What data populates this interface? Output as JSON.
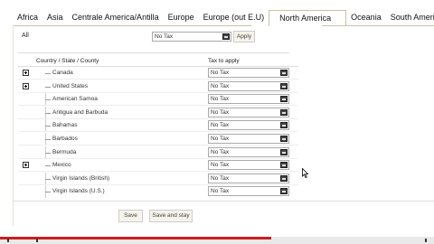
{
  "tabs": [
    {
      "label": "Africa",
      "active": false
    },
    {
      "label": "Asia",
      "active": false
    },
    {
      "label": "Centrale America/Antilla",
      "active": false
    },
    {
      "label": "Europe",
      "active": false
    },
    {
      "label": "Europe (out E.U)",
      "active": false
    },
    {
      "label": "North America",
      "active": true
    },
    {
      "label": "Oceania",
      "active": false
    },
    {
      "label": "South America",
      "active": false
    }
  ],
  "all_row": {
    "label": "All",
    "select_value": "No Tax",
    "apply_label": "Apply"
  },
  "table": {
    "col_country": "Country / State / County",
    "col_tax": "Tax to apply",
    "rows": [
      {
        "name": "Canada",
        "tax": "No Tax",
        "expandable": true
      },
      {
        "name": "United States",
        "tax": "No Tax",
        "expandable": true
      },
      {
        "name": "American Samoa",
        "tax": "No Tax",
        "expandable": false
      },
      {
        "name": "Antigua and Barbuda",
        "tax": "No Tax",
        "expandable": false
      },
      {
        "name": "Bahamas",
        "tax": "No Tax",
        "expandable": false
      },
      {
        "name": "Barbados",
        "tax": "No Tax",
        "expandable": false
      },
      {
        "name": "Bermuda",
        "tax": "No Tax",
        "expandable": false
      },
      {
        "name": "Mexico",
        "tax": "No Tax",
        "expandable": true
      },
      {
        "name": "Virgin Islands (British)",
        "tax": "No Tax",
        "expandable": false
      },
      {
        "name": "Virgin Islands (U.S.)",
        "tax": "No Tax",
        "expandable": false
      }
    ]
  },
  "footer": {
    "save_label": "Save",
    "save_and_stay_label": "Save and stay"
  },
  "colors": {
    "accent_progress": "#cc1f1f",
    "tab_border": "#c9c2a8"
  }
}
